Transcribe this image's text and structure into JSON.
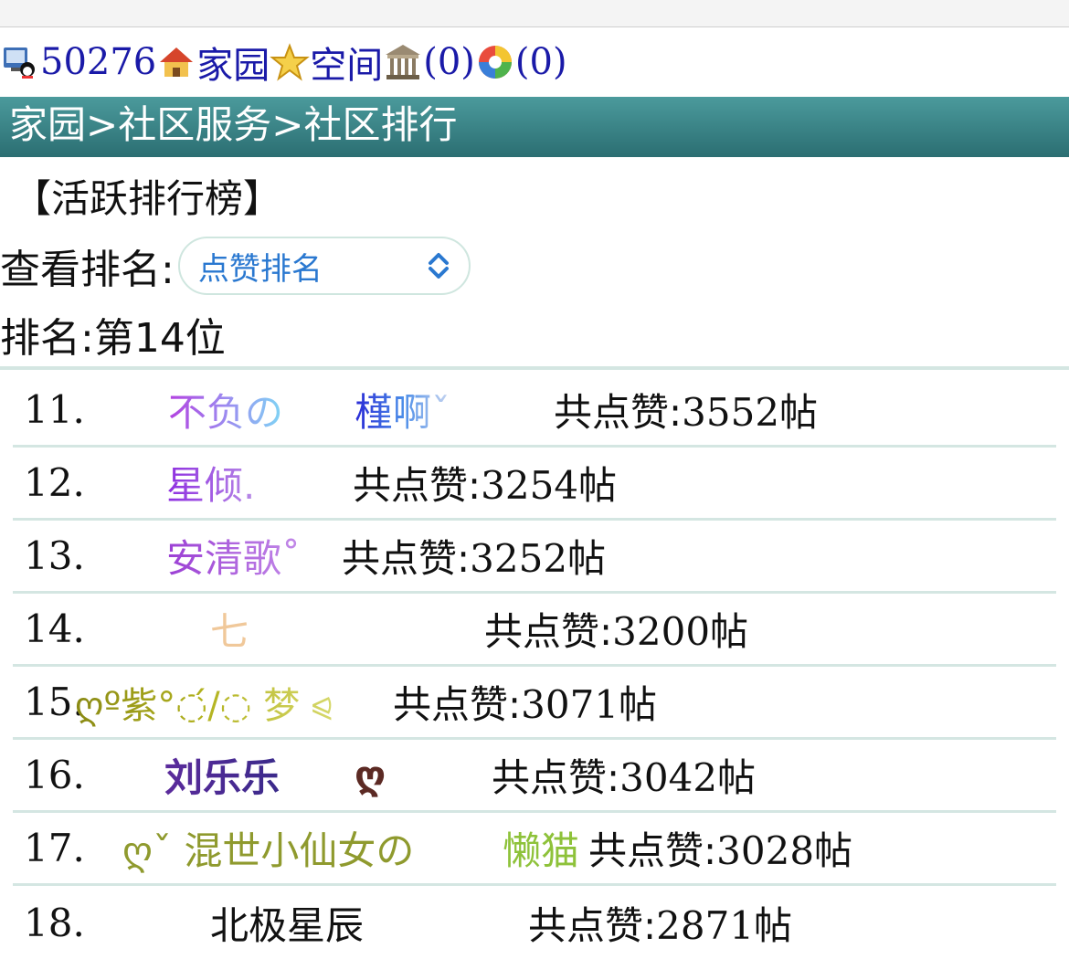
{
  "toolbar": {
    "user_id": "50276",
    "home_label": "家园",
    "space_label": "空间",
    "bank_count": "(0)",
    "album_count": "(0)"
  },
  "breadcrumb": {
    "home": "家园",
    "sep1": ">",
    "service": "社区服务",
    "sep2": ">",
    "ranking": "社区排行"
  },
  "board_title": "【活跃排行榜】",
  "view_rank": {
    "label": "查看排名:",
    "selected": "点赞排名"
  },
  "my_rank": "排名:第14位",
  "colors": {
    "header_bar": "#2f7a7c",
    "link": "#1a1aa8",
    "select_text": "#2a78d0",
    "divider": "#d4e6e2"
  },
  "rankings": [
    {
      "num": "11.",
      "name_a": "不负の",
      "name_b": "槿啊ˇ",
      "likes_prefix": "共点赞:",
      "likes": "3552",
      "likes_suffix": "帖"
    },
    {
      "num": "12.",
      "name_a": "星倾.",
      "likes_prefix": "共点赞:",
      "likes": "3254",
      "likes_suffix": "帖"
    },
    {
      "num": "13.",
      "name_a": "安清歌˚",
      "likes_prefix": "共点赞:",
      "likes": "3252",
      "likes_suffix": "帖"
    },
    {
      "num": "14.",
      "name_a": "七",
      "likes_prefix": "共点赞:",
      "likes": "3200",
      "likes_suffix": "帖"
    },
    {
      "num": "15.",
      "name_a": "ღº紫°◌́/◌ 梦 ⪨",
      "likes_prefix": "共点赞:",
      "likes": "3071",
      "likes_suffix": "帖"
    },
    {
      "num": "16.",
      "name_a": "刘乐乐",
      "name_b": "ღ",
      "likes_prefix": "共点赞:",
      "likes": "3042",
      "likes_suffix": "帖"
    },
    {
      "num": "17.",
      "name_a": "ღˇ 混世小仙女の",
      "name_b": "懒猫",
      "likes_prefix": "共点赞:",
      "likes": "3028",
      "likes_suffix": "帖"
    },
    {
      "num": "18.",
      "name_a": "北极星辰",
      "likes_prefix": "共点赞:",
      "likes": "2871",
      "likes_suffix": "帖"
    }
  ]
}
